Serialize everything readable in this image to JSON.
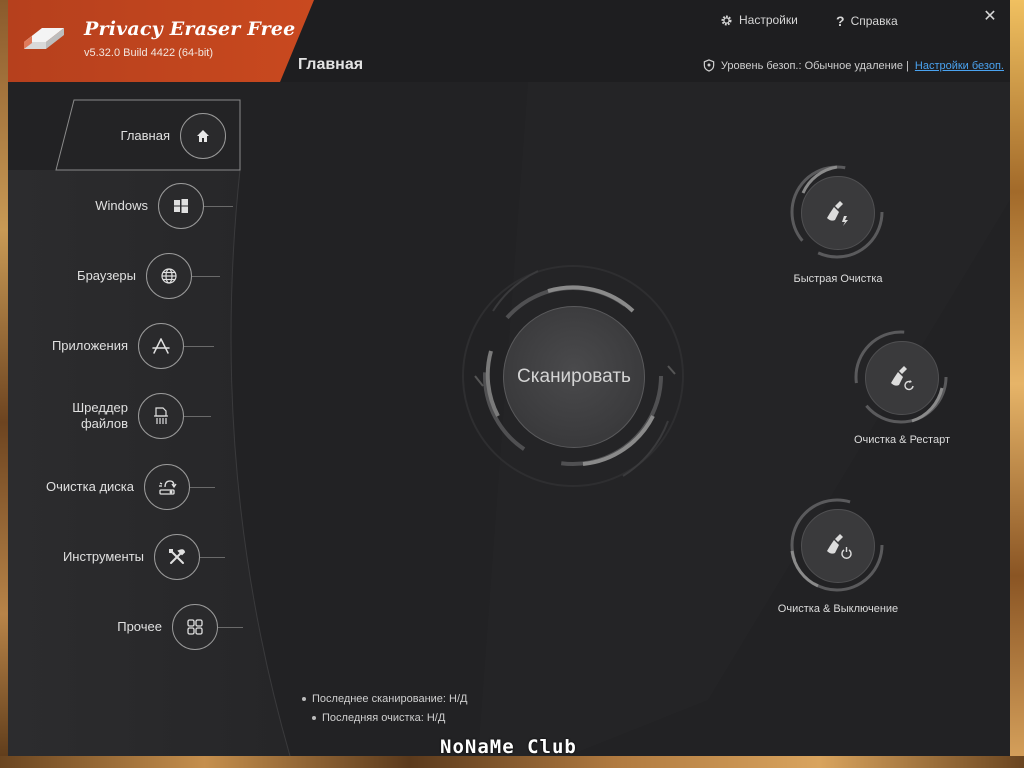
{
  "app": {
    "title": "Privacy Eraser Free",
    "version": "v5.32.0 Build 4422 (64-bit)",
    "brand_color": "#c8411b"
  },
  "topbar": {
    "settings_label": "Настройки",
    "help_label": "Справка",
    "close_label": "✕"
  },
  "header": {
    "page_title": "Главная",
    "security_label": "Уровень безоп.: Обычное удаление |",
    "security_link": "Настройки безоп."
  },
  "sidebar": {
    "items": [
      {
        "label": "Главная",
        "icon": "home-icon",
        "active": true
      },
      {
        "label": "Windows",
        "icon": "windows-icon"
      },
      {
        "label": "Браузеры",
        "icon": "globe-icon"
      },
      {
        "label": "Приложения",
        "icon": "apps-icon"
      },
      {
        "label": "Шреддер\nфайлов",
        "icon": "shredder-icon"
      },
      {
        "label": "Очистка диска",
        "icon": "disk-clean-icon"
      },
      {
        "label": "Инструменты",
        "icon": "tools-icon"
      },
      {
        "label": "Прочее",
        "icon": "grid-icon"
      }
    ]
  },
  "main": {
    "scan_label": "Сканировать",
    "actions": [
      {
        "label": "Быстрая Очистка",
        "icon": "quick-clean-icon"
      },
      {
        "label": "Очистка & Рестарт",
        "icon": "clean-restart-icon"
      },
      {
        "label": "Очистка & Выключение",
        "icon": "clean-shutdown-icon"
      }
    ],
    "status": {
      "last_scan": "Последнее сканирование:  Н/Д",
      "last_clean": "Последняя очистка:  Н/Д"
    }
  },
  "watermark": "NoNaMe Club"
}
